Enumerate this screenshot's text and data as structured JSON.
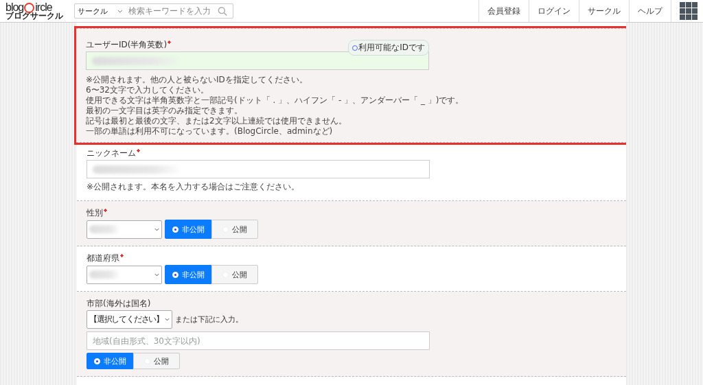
{
  "header": {
    "logo": {
      "word_start": "blog",
      "word_end": "ircle",
      "tagline": "ブログサークル"
    },
    "search": {
      "category": "サークル",
      "placeholder": "検索キーワードを入力"
    },
    "nav": [
      "会員登録",
      "ログイン",
      "サークル",
      "ヘルプ"
    ]
  },
  "form": {
    "sections": [
      {
        "kind": "text",
        "label": "ユーザーID(半角英数)",
        "required": true,
        "highlighted": true,
        "valid": true,
        "status": "利用可能なIDです",
        "notes": [
          "※公開されます。他の人と被らないIDを指定してください。",
          "6〜32文字で入力してください。",
          "使用できる文字は半角英数字と一部記号(ドット「 . 」、ハイフン「 - 」、アンダーバー「 _ 」)です。",
          "最初の一文字目は英字のみ指定できます。",
          "記号は最初と最後の文字、または2文字以上連続では使用できません。",
          "一部の単語は利用不可になっています。(BlogCircle、adminなど)"
        ]
      },
      {
        "kind": "text",
        "label": "ニックネーム",
        "required": true,
        "highlighted": false,
        "valid": false,
        "notes": [
          "※公開されます。本名を入力する場合はご注意ください。"
        ]
      },
      {
        "kind": "select",
        "label": "性別",
        "required": true,
        "privacy": [
          {
            "label": "非公開",
            "selected": true
          },
          {
            "label": "公開",
            "selected": false
          }
        ]
      },
      {
        "kind": "select",
        "label": "都道府県",
        "required": true,
        "privacy": [
          {
            "label": "非公開",
            "selected": true
          },
          {
            "label": "公開",
            "selected": false
          }
        ]
      },
      {
        "kind": "city",
        "label": "市部(海外は国名)",
        "select": "【選択してください】",
        "after": "または下記に入力。",
        "placeholder": "地域(自由形式、30文字以内)",
        "privacy": [
          {
            "label": "非公開",
            "selected": true
          },
          {
            "label": "公開",
            "selected": false
          }
        ]
      }
    ]
  }
}
